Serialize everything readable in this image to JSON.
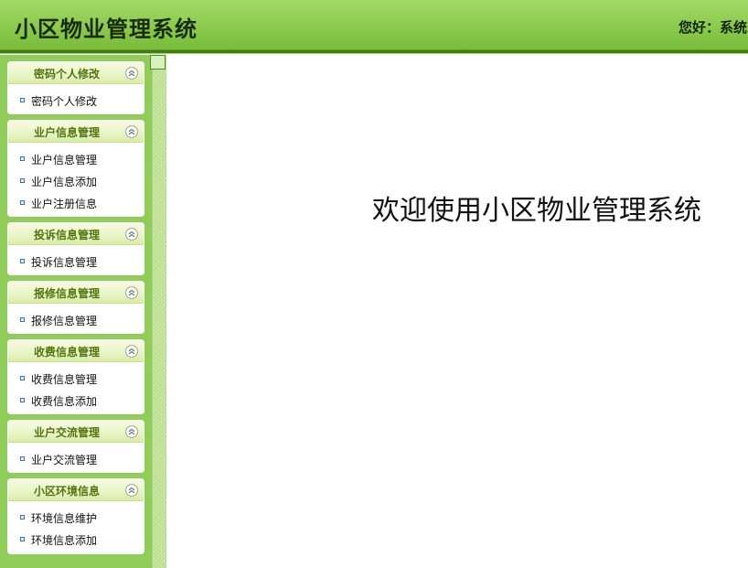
{
  "header": {
    "title": "小区物业管理系统",
    "greeting": "您好：系统"
  },
  "sidebar": {
    "panels": [
      {
        "title": "密码个人修改",
        "items": [
          {
            "label": "密码个人修改"
          }
        ]
      },
      {
        "title": "业户信息管理",
        "items": [
          {
            "label": "业户信息管理"
          },
          {
            "label": "业户信息添加"
          },
          {
            "label": "业户注册信息"
          }
        ]
      },
      {
        "title": "投诉信息管理",
        "items": [
          {
            "label": "投诉信息管理"
          }
        ]
      },
      {
        "title": "报修信息管理",
        "items": [
          {
            "label": "报修信息管理"
          }
        ]
      },
      {
        "title": "收费信息管理",
        "items": [
          {
            "label": "收费信息管理"
          },
          {
            "label": "收费信息添加"
          }
        ]
      },
      {
        "title": "业户交流管理",
        "items": [
          {
            "label": "业户交流管理"
          }
        ]
      },
      {
        "title": "小区环境信息",
        "items": [
          {
            "label": "环境信息维护"
          },
          {
            "label": "环境信息添加"
          }
        ]
      }
    ]
  },
  "main": {
    "welcome": "欢迎使用小区物业管理系统"
  },
  "icons": {
    "panel_toggle": "chevron-up-icon",
    "menu_bullet": "square-bullet-icon"
  },
  "colors": {
    "header_green": "#8fcd52",
    "header_line": "#3f7d12",
    "sidebar_bg": "#8fcc5a",
    "panel_title": "#54740e"
  }
}
